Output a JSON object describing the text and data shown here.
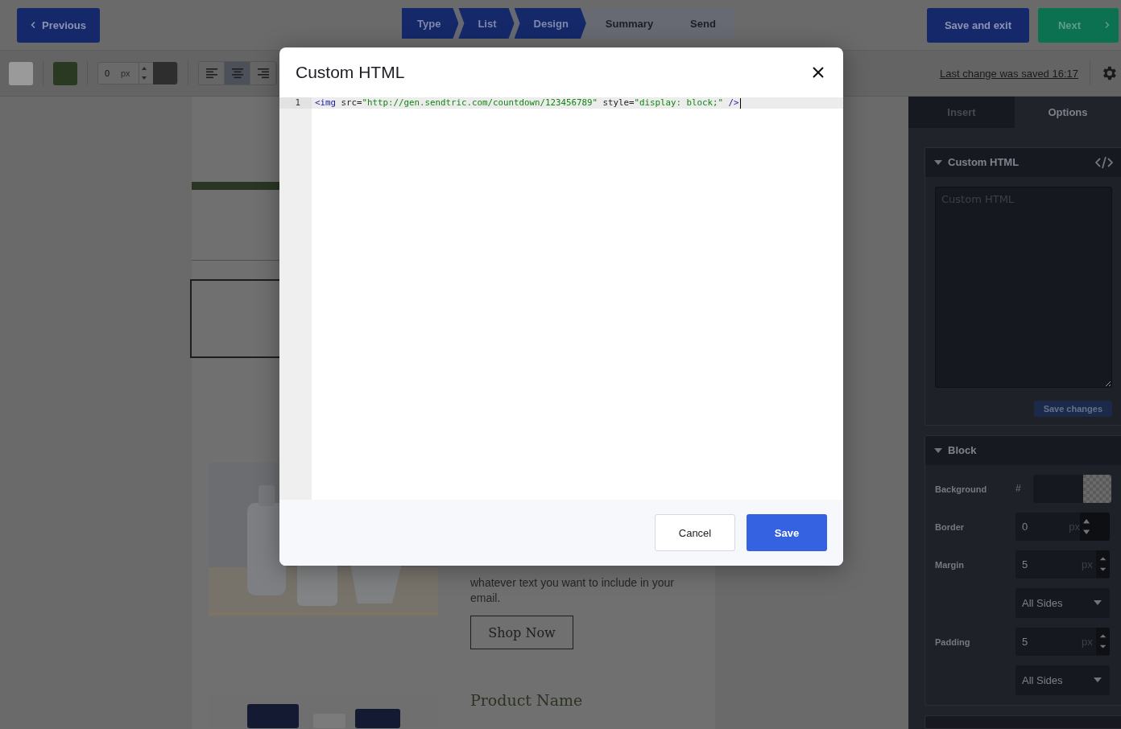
{
  "top_bar": {
    "previous": "Previous",
    "steps": [
      {
        "label": "Type",
        "completed": true
      },
      {
        "label": "List",
        "completed": true
      },
      {
        "label": "Design",
        "completed": true
      },
      {
        "label": "Summary",
        "completed": false
      },
      {
        "label": "Send",
        "completed": false
      }
    ],
    "save_exit": "Save and exit",
    "next": "Next"
  },
  "toolbar": {
    "border_value": "0",
    "border_unit": "px",
    "alignments": [
      {
        "kind": "left",
        "selected": false
      },
      {
        "kind": "center",
        "selected": true
      },
      {
        "kind": "right",
        "selected": false
      }
    ],
    "last_saved": "Last change was saved 16:17"
  },
  "email": {
    "paragraph": "whatever text you want to include in your email.",
    "button": "Shop Now",
    "product_title": "Product Name"
  },
  "sidebar": {
    "tabs": [
      {
        "label": "Insert",
        "selected": false
      },
      {
        "label": "Options",
        "selected": true
      }
    ],
    "custom_html": {
      "title": "Custom HTML",
      "expanded": true,
      "placeholder": "Custom HTML",
      "button": "Save changes"
    },
    "block": {
      "title": "Block",
      "expanded": true,
      "fields": [
        {
          "kind": "color",
          "label": "Background",
          "prefix": "#"
        },
        {
          "kind": "number",
          "label": "Border",
          "value": "0",
          "unit": "px"
        },
        {
          "kind": "sides",
          "label": "Margin",
          "value": "5",
          "unit": "px",
          "sides": "All Sides"
        },
        {
          "kind": "sides",
          "label": "Padding",
          "value": "5",
          "unit": "px",
          "sides": "All Sides"
        }
      ]
    }
  },
  "modal": {
    "title": "Custom HTML",
    "code_lines": [
      {
        "number": "1",
        "tokens": [
          {
            "kind": "tag",
            "text": "<img"
          },
          {
            "kind": "plain",
            "text": " src="
          },
          {
            "kind": "string",
            "text": "\"http://gen.sendtric.com/countdown/123456789\""
          },
          {
            "kind": "plain",
            "text": " style="
          },
          {
            "kind": "string",
            "text": "\"display: block;\""
          },
          {
            "kind": "tag",
            "text": " />"
          }
        ]
      }
    ],
    "cancel": "Cancel",
    "save": "Save"
  }
}
